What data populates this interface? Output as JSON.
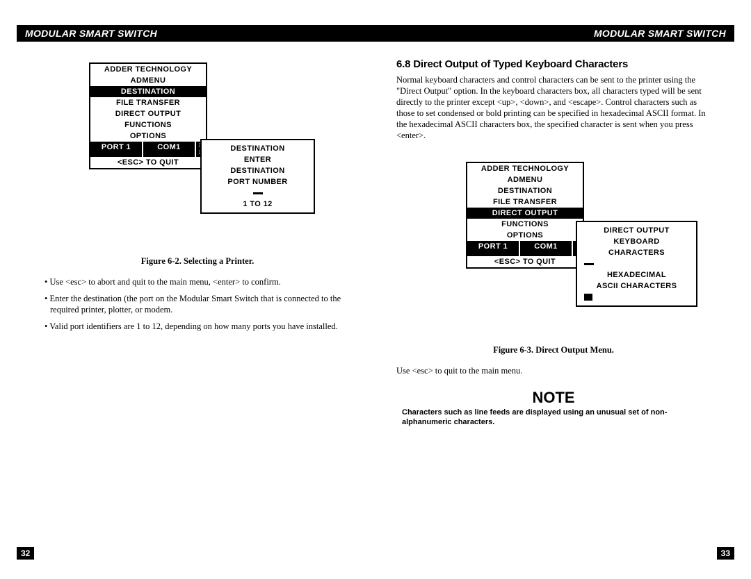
{
  "header": {
    "title": "MODULAR SMART SWITCH"
  },
  "left": {
    "menu1": {
      "line1": "ADDER TECHNOLOGY",
      "line2": "ADMENU",
      "items": [
        "DESTINATION",
        "FILE TRANSFER",
        "DIRECT OUTPUT",
        "FUNCTIONS",
        "OPTIONS"
      ],
      "selectedIndex": 0,
      "port_label": "PORT  1",
      "com_label": "COM1",
      "esc_line": "<ESC>   TO   QUIT"
    },
    "menu2": {
      "title": "DESTINATION",
      "l1": "ENTER",
      "l2": "DESTINATION",
      "l3": "PORT NUMBER",
      "range": "1 TO 12"
    },
    "fig_caption": "Figure 6-2.  Selecting a Printer.",
    "bullets": [
      "Use <esc> to abort and quit to the main menu, <enter> to confirm.",
      "Enter the destination (the port on the Modular Smart Switch that is connected to the required printer, plotter, or modem.",
      "Valid port identifiers are 1 to 12, depending on how many ports you have installed."
    ],
    "page_num": "32"
  },
  "right": {
    "section_head": "6.8  Direct Output of Typed Keyboard Characters",
    "para": "Normal keyboard characters and control characters can be sent to the printer using the \"Direct Output\" option.  In the keyboard characters box, all characters typed will be sent directly to the printer except <up>, <down>, and <escape>.  Control characters such as those to set condensed or bold printing can be specified in hexadecimal ASCII format.  In the hexadecimal ASCII characters box, the specified character is sent when you press <enter>.",
    "menu1": {
      "line1": "ADDER TECHNOLOGY",
      "line2": "ADMENU",
      "items": [
        "DESTINATION",
        "FILE TRANSFER",
        "DIRECT OUTPUT",
        "FUNCTIONS",
        "OPTIONS"
      ],
      "selectedIndex": 2,
      "port_label": "PORT  1",
      "com_label": "COM1",
      "esc_line": "<ESC>   TO   QUIT"
    },
    "menu2": {
      "title": "DIRECT OUTPUT",
      "l1": "KEYBOARD",
      "l2": "CHARACTERS",
      "l3": "HEXADECIMAL",
      "l4": "ASCII CHARACTERS"
    },
    "fig_caption": "Figure 6-3.  Direct Output Menu.",
    "post_fig": "Use <esc> to quit to the main menu.",
    "note_head": "NOTE",
    "note_body": "Characters such as line feeds are displayed using an unusual set of non-alphanumeric characters.",
    "page_num": "33"
  }
}
